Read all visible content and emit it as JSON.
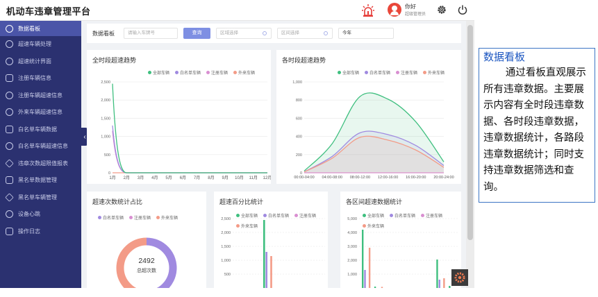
{
  "header": {
    "title": "机动车违章管理平台",
    "user_greeting": "你好",
    "user_role": "超级管理员"
  },
  "sidebar": {
    "items": [
      {
        "label": "数据看板",
        "active": true
      },
      {
        "label": "超速车辆处理"
      },
      {
        "label": "超速统计界面"
      },
      {
        "label": "注册车辆信息"
      },
      {
        "label": "注册车辆超速信息"
      },
      {
        "label": "外来车辆超速信息"
      },
      {
        "label": "白名单车辆数据"
      },
      {
        "label": "白名单车辆超速信息"
      },
      {
        "label": "违章次数超限值报表"
      },
      {
        "label": "黑名单数据管理"
      },
      {
        "label": "黑名单车辆管理"
      },
      {
        "label": "设备心跳"
      },
      {
        "label": "操作日志"
      }
    ]
  },
  "filter_bar": {
    "label": "数据看板",
    "plate_placeholder": "请输入车牌号",
    "query_label": "查询",
    "area_placeholder": "区域选择",
    "section_placeholder": "区间选择",
    "period_value": "今年"
  },
  "legend": {
    "all": "全部车辆",
    "white": "白名单车辆",
    "registered": "注册车辆",
    "external": "外来车辆"
  },
  "colors": {
    "all": "#3fbf7f",
    "white": "#a08ae0",
    "registered": "#d98fd1",
    "external": "#f39b87"
  },
  "chart_data": [
    {
      "type": "line",
      "title": "全时段超速趋势",
      "categories": [
        "1月",
        "2月",
        "3月",
        "4月",
        "5月",
        "6月",
        "7月",
        "8月",
        "9月",
        "10月",
        "11月",
        "12月"
      ],
      "ylim": [
        0,
        2500
      ],
      "yticks": [
        0,
        500,
        1000,
        1500,
        2000,
        2500
      ],
      "series": [
        {
          "name": "全部车辆",
          "values": [
            2450,
            0,
            0,
            0,
            0,
            0,
            0,
            0,
            0,
            0,
            0,
            0
          ]
        },
        {
          "name": "白名单车辆",
          "values": [
            1300,
            0,
            0,
            0,
            0,
            0,
            0,
            0,
            0,
            0,
            0,
            0
          ]
        },
        {
          "name": "注册车辆",
          "values": [
            1150,
            0,
            0,
            0,
            0,
            0,
            0,
            0,
            0,
            0,
            0,
            0
          ]
        },
        {
          "name": "外来车辆",
          "values": [
            0,
            0,
            0,
            0,
            0,
            0,
            0,
            0,
            0,
            0,
            0,
            0
          ]
        }
      ]
    },
    {
      "type": "area",
      "title": "各时段超速趋势",
      "categories": [
        "00:00-04:00",
        "04:00-08:00",
        "08:00-12:00",
        "12:00-16:00",
        "16:00-20:00",
        "20:00-24:00"
      ],
      "ylim": [
        0,
        1000
      ],
      "yticks": [
        0,
        200,
        400,
        600,
        800,
        1000
      ],
      "series": [
        {
          "name": "全部车辆",
          "values": [
            20,
            320,
            840,
            810,
            560,
            120
          ]
        },
        {
          "name": "白名单车辆",
          "values": [
            10,
            180,
            440,
            420,
            300,
            80
          ]
        },
        {
          "name": "注册车辆",
          "values": [
            0,
            0,
            0,
            0,
            0,
            0
          ]
        },
        {
          "name": "外来车辆",
          "values": [
            10,
            160,
            390,
            360,
            250,
            60
          ]
        }
      ]
    },
    {
      "type": "pie",
      "title": "超速次数统计占比",
      "total_value": "2492",
      "total_label": "总超次数",
      "series": [
        {
          "name": "白名单车辆",
          "value": 1300
        },
        {
          "name": "注册车辆",
          "value": 0
        },
        {
          "name": "外来车辆",
          "value": 1192
        }
      ]
    },
    {
      "type": "bar",
      "title": "超速百分比统计",
      "ylim": [
        0,
        2500
      ],
      "yticks": [
        0,
        500,
        1000,
        1500,
        2000,
        2500
      ],
      "series": [
        {
          "name": "全部车辆",
          "values": [
            2450
          ]
        },
        {
          "name": "白名单车辆",
          "values": [
            1300
          ]
        },
        {
          "name": "注册车辆",
          "values": [
            0
          ]
        },
        {
          "name": "外来车辆",
          "values": [
            1150
          ]
        }
      ]
    },
    {
      "type": "bar",
      "title": "各区间超速数据统计",
      "ylim": [
        0,
        5000
      ],
      "yticks": [
        0,
        1000,
        2000,
        3000,
        4000,
        5000
      ],
      "series": [
        {
          "name": "全部车辆",
          "values": [
            4200,
            100,
            0,
            0,
            0,
            0,
            2050,
            150
          ]
        },
        {
          "name": "白名单车辆",
          "values": [
            1300,
            0,
            0,
            0,
            0,
            0,
            600,
            0
          ]
        },
        {
          "name": "注册车辆",
          "values": [
            0,
            0,
            0,
            0,
            0,
            0,
            0,
            0
          ]
        },
        {
          "name": "外来车辆",
          "values": [
            2900,
            80,
            0,
            0,
            0,
            0,
            700,
            0
          ]
        }
      ]
    }
  ],
  "annotation": {
    "title": "数据看板",
    "body": "通过看板直观展示所有违章数据。主要展示内容有全时段违章数据、各时段违章数据，违章数据统计，各路段违章数据统计；同时支持违章数据筛选和查询。"
  }
}
